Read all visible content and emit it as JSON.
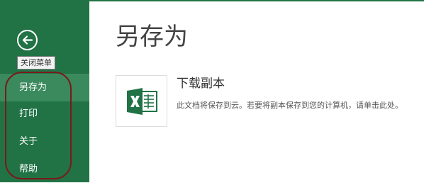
{
  "backstage": {
    "accent_color": "#217346",
    "back_icon": "back-arrow-icon",
    "back_tooltip": "关闭菜单",
    "nav": [
      {
        "label": "另存为",
        "active": true
      },
      {
        "label": "打印",
        "active": false
      },
      {
        "label": "关于",
        "active": false
      },
      {
        "label": "帮助",
        "active": false
      }
    ]
  },
  "main": {
    "title": "另存为",
    "option": {
      "icon": "excel-icon",
      "title": "下载副本",
      "description": "此文档将保存到云。若要将副本保存到您的计算机，请单击此处。"
    }
  }
}
